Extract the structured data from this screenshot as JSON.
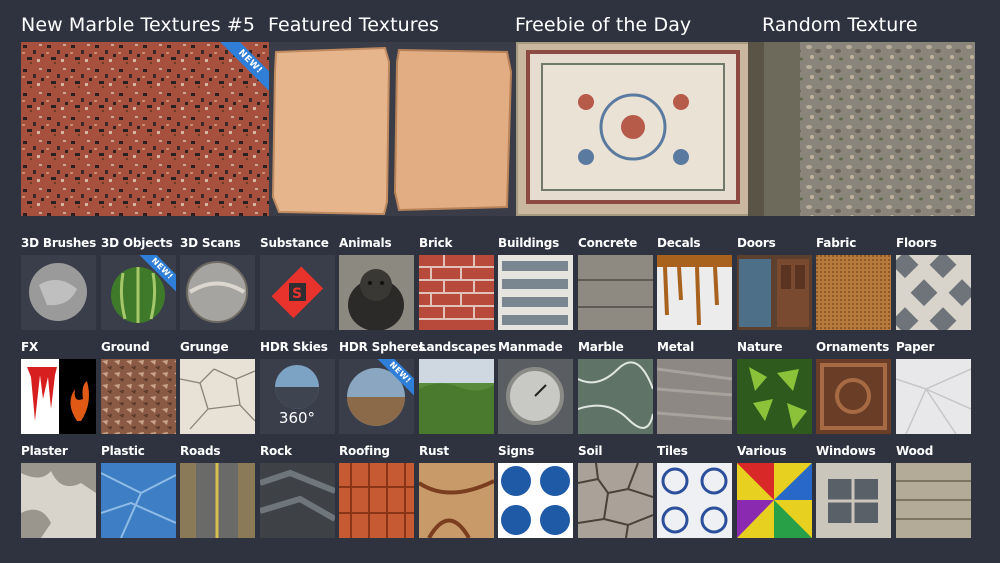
{
  "featured": {
    "new_marble_title": "New Marble Textures #5",
    "featured_title": "Featured Textures",
    "freebie_title": "Freebie of the Day",
    "random_title": "Random Texture",
    "new_badge": "NEW!"
  },
  "categories": {
    "row1": [
      "3D Brushes",
      "3D Objects",
      "3D Scans",
      "Substance",
      "Animals",
      "Brick",
      "Buildings",
      "Concrete",
      "Decals",
      "Doors",
      "Fabric",
      "Floors"
    ],
    "row2": [
      "FX",
      "Ground",
      "Grunge",
      "HDR Skies",
      "HDR Spheres",
      "Landscapes",
      "Manmade",
      "Marble",
      "Metal",
      "Nature",
      "Ornaments",
      "Paper"
    ],
    "row3": [
      "Plaster",
      "Plastic",
      "Roads",
      "Rock",
      "Roofing",
      "Rust",
      "Signs",
      "Soil",
      "Tiles",
      "Various",
      "Windows",
      "Wood"
    ]
  },
  "badges": {
    "new": "NEW!",
    "hdr_label": "360°"
  },
  "colors": {
    "background": "#2f3340",
    "ribbon": "#2f7fd8"
  }
}
